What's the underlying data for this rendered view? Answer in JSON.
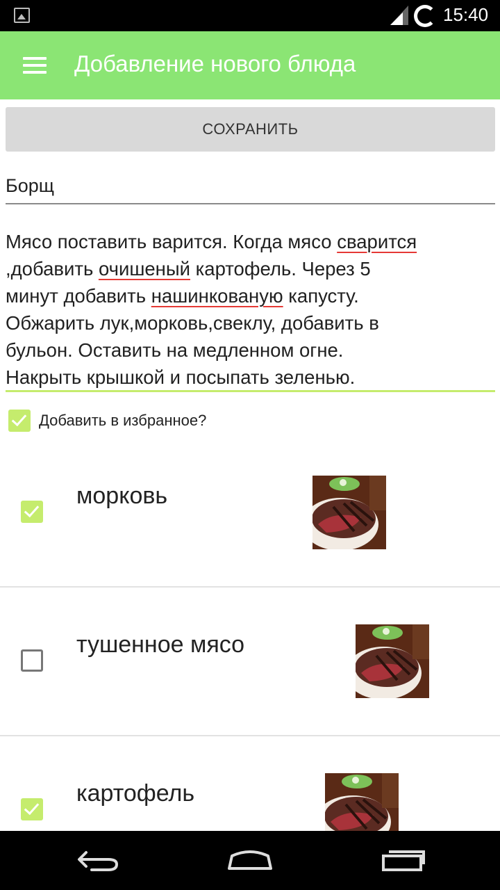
{
  "status_bar": {
    "time": "15:40",
    "icons": [
      "image-icon",
      "signal-icon",
      "sync-icon"
    ]
  },
  "app_bar": {
    "title": "Добавление нового блюда",
    "menu_icon": "hamburger-icon"
  },
  "form": {
    "save_label": "СОХРАНИТЬ",
    "dish_name": "Борщ",
    "recipe_lines": [
      [
        "Мясо поставить варится. Когда мясо ",
        "сварится"
      ],
      [
        ",добавить ",
        "очишеный",
        " картофель. Через 5"
      ],
      [
        "минут добавить ",
        "нашинкованую",
        " капусту."
      ],
      [
        "Обжарить лук,морковь,свеклу, добавить в"
      ],
      [
        "бульон. Оставить на медленном огне."
      ],
      [
        "Накрыть крышкой и посыпать зеленью."
      ]
    ],
    "favorite_label": "Добавить в избранное?",
    "favorite_checked": true
  },
  "ingredients": [
    {
      "name": "морковь",
      "checked": true
    },
    {
      "name": "тушенное мясо",
      "checked": false
    },
    {
      "name": "картофель",
      "checked": true
    }
  ],
  "colors": {
    "accent": "#8be574",
    "checkbox": "#c5ec6d",
    "spell_underline": "#e53935",
    "button": "#d9d9d9"
  },
  "nav_bar": {
    "icons": [
      "back-icon",
      "home-icon",
      "recents-icon"
    ]
  }
}
